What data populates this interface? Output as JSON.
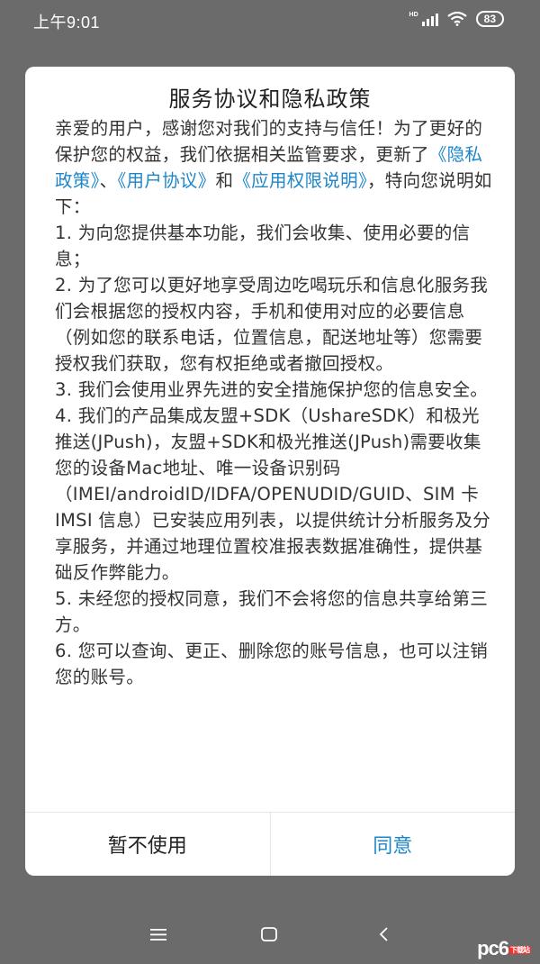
{
  "status_bar": {
    "time": "上午9:01",
    "network_label": "HD",
    "battery": "83"
  },
  "dialog": {
    "title": "服务协议和隐私政策",
    "intro": {
      "line_start": "亲爱的用户，感谢您对我们的支持与信任！为了更好的保护您的权益，我们依据相关监管要求，更新了",
      "link_privacy": "《隐私政策》",
      "sep1": "、",
      "link_user": "《用户协议》",
      "sep2": "和",
      "link_permission": "《应用权限说明》",
      "line_end": "，特向您说明如下："
    },
    "items": [
      "1. 为向您提供基本功能，我们会收集、使用必要的信息；",
      "2. 为了您可以更好地享受周边吃喝玩乐和信息化服务我们会根据您的授权内容，手机和使用对应的必要信息（例如您的联系电话，位置信息，配送地址等）您需要授权我们获取，您有权拒绝或者撤回授权。",
      "3. 我们会使用业界先进的安全措施保护您的信息安全。",
      "4. 我们的产品集成友盟+SDK（UshareSDK）和极光推送(JPush)，友盟+SDK和极光推送(JPush)需要收集您的设备Mac地址、唯一设备识别码（IMEI/androidID/IDFA/OPENUDID/GUID、SIM 卡 IMSI 信息）已安装应用列表，以提供统计分析服务及分享服务，并通过地理位置校准报表数据准确性，提供基础反作弊能力。",
      "5. 未经您的授权同意，我们不会将您的信息共享给第三方。",
      "6. 您可以查询、更正、删除您的账号信息，也可以注销您的账号。"
    ],
    "cancel_label": "暂不使用",
    "agree_label": "同意"
  },
  "watermark": {
    "text": "pc6",
    "sub": "下载站"
  },
  "colors": {
    "link": "#1d86c8",
    "overlay": "#6b6b6b"
  }
}
